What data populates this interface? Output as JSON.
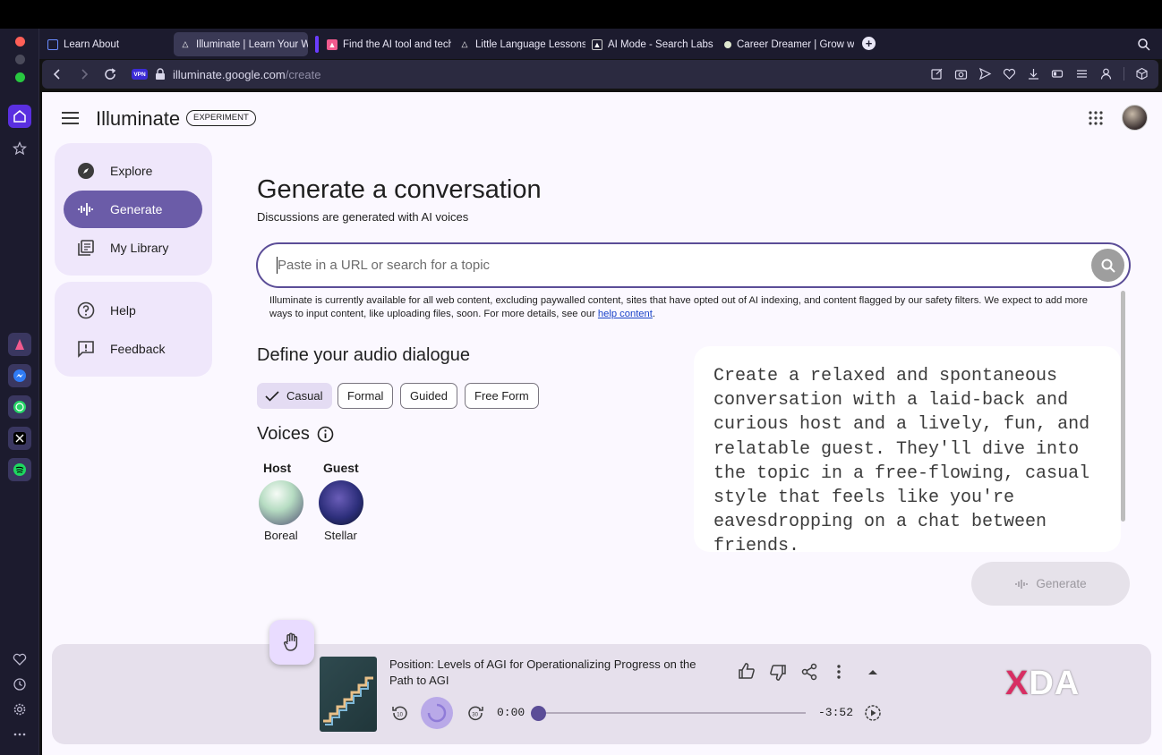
{
  "browser": {
    "tabs": [
      {
        "label": "Learn About",
        "active": false
      },
      {
        "label": "Illuminate | Learn Your W",
        "active": true
      },
      {
        "label": "Find the AI tool and tech",
        "active": false
      },
      {
        "label": "Little Language Lessons",
        "active": false
      },
      {
        "label": "AI Mode - Search Labs",
        "active": false
      },
      {
        "label": "Career Dreamer | Grow w",
        "active": false
      }
    ],
    "vpn_badge": "VPN",
    "url_host": "illuminate.google.com",
    "url_path": "/create"
  },
  "app": {
    "title": "Illuminate",
    "badge": "EXPERIMENT"
  },
  "nav": {
    "items": [
      {
        "label": "Explore"
      },
      {
        "label": "Generate",
        "selected": true
      },
      {
        "label": "My Library"
      }
    ],
    "secondary": [
      {
        "label": "Help"
      },
      {
        "label": "Feedback"
      }
    ]
  },
  "main": {
    "heading": "Generate a conversation",
    "subheading": "Discussions are generated with AI voices",
    "search_placeholder": "Paste in a URL or search for a topic",
    "notice": "Illuminate is currently available for all web content, excluding paywalled content, sites that have opted out of AI indexing, and content flagged by our safety filters. We expect to add more ways to input content, like uploading files, soon. For more details, see our",
    "notice_link": "help content",
    "notice_end": ".",
    "dialogue_heading": "Define your audio dialogue",
    "styles": [
      {
        "label": "Casual",
        "selected": true
      },
      {
        "label": "Formal"
      },
      {
        "label": "Guided"
      },
      {
        "label": "Free Form"
      }
    ],
    "voices_heading": "Voices",
    "host_label": "Host",
    "guest_label": "Guest",
    "host_voice": "Boreal",
    "guest_voice": "Stellar",
    "prompt_text": "Create a relaxed and spontaneous conversation with a laid-back and curious host and a lively, fun, and relatable guest. They'll dive into the topic in a free-flowing, casual style that feels like you're eavesdropping on a chat between friends.",
    "generate_label": "Generate"
  },
  "player": {
    "title": "Position: Levels of AGI for Operationalizing Progress on the Path to AGI",
    "elapsed": "0:00",
    "remaining": "-3:52",
    "progress": 0.0
  },
  "watermark": {
    "prefix": "X",
    "text": "DA"
  },
  "colors": {
    "accent": "#5b4d97",
    "nav_selected": "#6b5ca8",
    "page_bg": "#fbf8ff",
    "nav_bg": "#efe7fb",
    "browser_bg": "#1c1b2e"
  }
}
